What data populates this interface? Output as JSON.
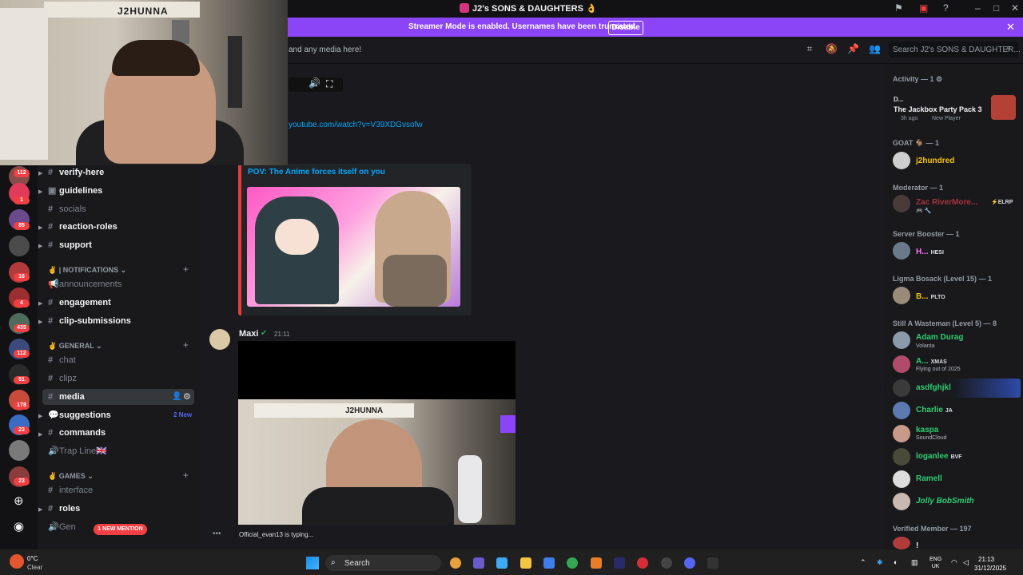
{
  "window": {
    "title": "J2's SONS & DAUGHTERS 👌"
  },
  "banner": {
    "text": "Streamer Mode is enabled. Usernames have been truncated.",
    "button": "Disable"
  },
  "header": {
    "topic": "and any media here!",
    "search_placeholder": "Search J2's SONS & DAUGHTER..."
  },
  "webcam": {
    "label": "J2HUNNA"
  },
  "rail_badges": [
    "112",
    "1",
    "85",
    "16",
    "4",
    "435",
    "112",
    "51",
    "178",
    "23",
    "23"
  ],
  "channels": {
    "top": [
      {
        "name": "verify-here",
        "bright": true
      },
      {
        "name": "guidelines",
        "bright": true
      },
      {
        "name": "socials",
        "bright": false
      },
      {
        "name": "reaction-roles",
        "bright": true
      },
      {
        "name": "support",
        "bright": true
      }
    ],
    "cat_notifications": "| NOTIFICATIONS",
    "notifications": [
      {
        "name": "announcements",
        "bright": false
      },
      {
        "name": "engagement",
        "bright": true
      },
      {
        "name": "clip-submissions",
        "bright": true
      }
    ],
    "cat_general": "GENERAL",
    "general": [
      {
        "name": "chat",
        "bright": false
      },
      {
        "name": "clipz",
        "bright": false
      },
      {
        "name": "media",
        "bright": true
      },
      {
        "name": "suggestions",
        "bright": true,
        "extra": "2 New"
      },
      {
        "name": "commands",
        "bright": true
      },
      {
        "name": "Trap Line🇬🇧",
        "bright": false
      }
    ],
    "cat_games": "GAMES",
    "games": [
      {
        "name": "interface",
        "bright": false
      },
      {
        "name": "roles",
        "bright": true
      },
      {
        "name": "Gen",
        "bright": false
      }
    ],
    "new_mention": "1 NEW MENTION"
  },
  "chat": {
    "link": "youtube.com/watch?v=V39XDGvsofw",
    "embed_title": "POV: The Anime forces itself on you",
    "message": {
      "author": "Maxi",
      "time": "21:11"
    },
    "video_label": "J2HUNNA",
    "typing": "Official_evan13 is typing..."
  },
  "members": {
    "activity_header": "Activity — 1",
    "activity": {
      "name": "D...",
      "game": "The Jackbox Party Pack 3",
      "meta": "3h ago",
      "meta2": "New Player"
    },
    "groups": [
      {
        "header": "GOAT 🐐 — 1",
        "members": [
          {
            "name": "j2hundred",
            "color": "#f5c400"
          }
        ]
      },
      {
        "header": "Moderator — 1",
        "members": [
          {
            "name": "Zac RiverMore...",
            "color": "#a8323e",
            "tag": "ELRP",
            "sub": "🎮 🔧"
          }
        ]
      },
      {
        "header": "Server Booster — 1",
        "members": [
          {
            "name": "H...",
            "color": "#ff73fa",
            "tag": "HESI"
          }
        ]
      },
      {
        "header": "Ligma Bosack (Level 15) — 1",
        "members": [
          {
            "name": "B...",
            "color": "#f5c400",
            "tag": "PLTO"
          }
        ]
      },
      {
        "header": "Still A Wasteman (Level 5) — 8",
        "members": [
          {
            "name": "Adam Durag",
            "color": "#2ecc71",
            "sub": "Volanta"
          },
          {
            "name": "A...",
            "color": "#2ecc71",
            "tag": "XMAS",
            "sub": "Flying out of 2025"
          },
          {
            "name": "asdfghjkl",
            "color": "#2ecc71"
          },
          {
            "name": "Charlie",
            "color": "#2ecc71",
            "tag": "JA"
          },
          {
            "name": "kaspa",
            "color": "#2ecc71",
            "sub": "SoundCloud"
          },
          {
            "name": "loganlee",
            "color": "#2ecc71",
            "tag": "BVF"
          },
          {
            "name": "Ramell",
            "color": "#2ecc71"
          },
          {
            "name": "Jolly BobSmith",
            "color": "#2ecc71"
          }
        ]
      },
      {
        "header": "Verified Member — 197",
        "members": [
          {
            "name": "!",
            "color": "#f2f3f5"
          }
        ]
      }
    ]
  },
  "taskbar": {
    "weather_temp": "0°C",
    "weather_cond": "Clear",
    "search": "Search",
    "lang1": "ENG",
    "lang2": "UK",
    "time": "21:13",
    "date": "31/12/2025"
  },
  "colors": {
    "banner": "#8c44f7",
    "link": "#00a8fc",
    "mention": "#f23f43"
  }
}
